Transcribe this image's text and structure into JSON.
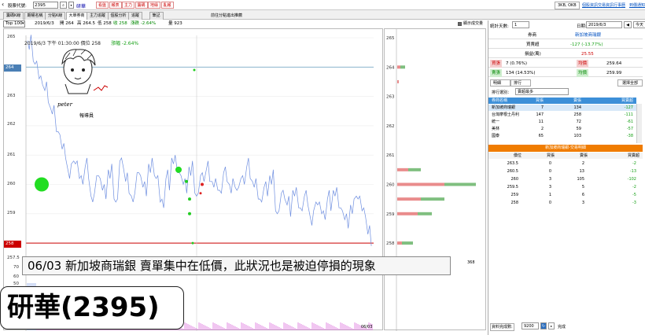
{
  "toolbar": {
    "code_label": "股票代號:",
    "code_value": "2395",
    "stock_name": "研華",
    "red_buttons": [
      "看盤",
      "報表",
      "主力",
      "籌碼",
      "地緣",
      "亂報"
    ],
    "info_text": "3KB, OKB",
    "links": [
      "個股資訊",
      "交易資訊",
      "行事曆",
      "到價通知"
    ]
  },
  "tabs": [
    "籌碼K線",
    "期權名稱",
    "分點K線",
    "大單券商",
    "主力追蹤",
    "個股分析",
    "追蹤",
    "筆記"
  ],
  "banner_text": "前往分點進出推薦",
  "infobar": {
    "range": "Top 100",
    "date": "2019/6/3",
    "open": "開 264",
    "high": "高 264.5",
    "low": "低 258",
    "close": "收 258",
    "change": "漲跌 -2.64%",
    "vol_label": "量 923"
  },
  "chart": {
    "cursor_text": "2019/6/3 下午 01:30:00  價位 258",
    "cursor_change": "漲幅 -2.64%",
    "y_labels": [
      "265",
      "264",
      "263",
      "262",
      "261",
      "260",
      "259",
      "258",
      "257.5"
    ],
    "highlight_top": "264",
    "highlight_bottom": "258",
    "vol_labels": [
      "70",
      "60",
      "50"
    ],
    "date_label": "06/03",
    "side_y_labels": [
      "265",
      "264",
      "263",
      "262",
      "261",
      "260",
      "259",
      "258"
    ],
    "side_vol_label": "368",
    "show_volume_label": "顯示成交量",
    "logo_text": "peter",
    "logo_sub": "報導員"
  },
  "overlay_caption": "06/03 新加坡商瑞銀 賣單集中在低價，此狀況也是被迫停損的現象",
  "big_title": "研華(2395)",
  "right": {
    "days_label": "統計天數:",
    "days_value": "1",
    "date_label": "日期:",
    "date_value": "2019/6/3",
    "today_btn": "今天",
    "broker_label": "券商",
    "broker_value": "新加坡商瑞銀",
    "net_label": "買賣超",
    "net_value": "-127 (-13.77%)",
    "avg_label": "損益(萬)",
    "avg_value": "25.55",
    "buy_label": "買張",
    "buy_value": "7 (0.76%)",
    "buy_avg_label": "均價",
    "buy_avg_value": "259.64",
    "sell_label": "賣張",
    "sell_value": "134 (14.53%)",
    "sell_avg_label": "均價",
    "sell_avg_value": "259.99",
    "subtab_1": "明細",
    "subtab_2": "排行",
    "select_all_btn": "選擇全部",
    "rank_label": "排行選別：",
    "rank_value": "賣超最多",
    "rank_headers": [
      "券商名稱",
      "買張",
      "賣張",
      "買賣超"
    ],
    "rank_rows": [
      [
        "新加坡商瑞銀",
        "7",
        "134",
        "-127"
      ],
      [
        "台灣摩根士丹利",
        "147",
        "258",
        "-111"
      ],
      [
        "統一",
        "11",
        "72",
        "-61"
      ],
      [
        "美林",
        "2",
        "59",
        "-57"
      ],
      [
        "國泰",
        "65",
        "103",
        "-38"
      ]
    ],
    "ob_title": "新加坡商瑞銀-交易明細",
    "ob_headers": [
      "價位",
      "買張",
      "賣張",
      "買賣超"
    ],
    "ob_rows": [
      [
        "263.5",
        "0",
        "2",
        "-2"
      ],
      [
        "260.5",
        "0",
        "13",
        "-13"
      ],
      [
        "260",
        "3",
        "105",
        "-102"
      ],
      [
        "259.5",
        "3",
        "5",
        "-2"
      ],
      [
        "259",
        "1",
        "6",
        "-5"
      ],
      [
        "258",
        "0",
        "3",
        "-3"
      ]
    ],
    "bottom_label": "資料完成數:",
    "bottom_value": "9200",
    "bottom_status": "完成"
  }
}
